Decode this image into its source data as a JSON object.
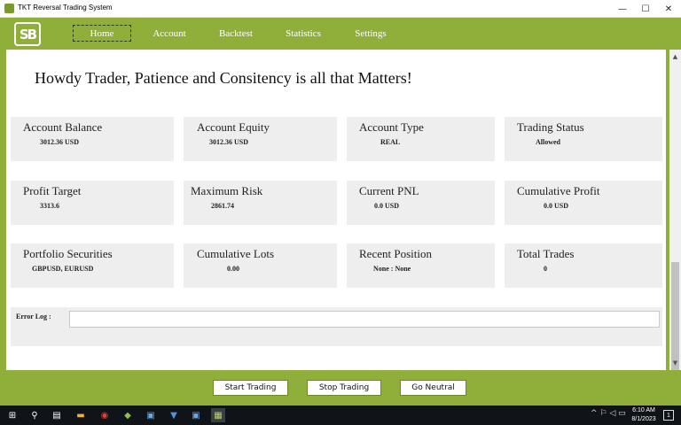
{
  "window": {
    "title": "TKT Reversal Trading System",
    "controls": [
      "—",
      "☐",
      "✕"
    ]
  },
  "header": {
    "logo_text": "SB",
    "nav": [
      {
        "label": "Home",
        "active": true
      },
      {
        "label": "Account",
        "active": false
      },
      {
        "label": "Backtest",
        "active": false
      },
      {
        "label": "Statistics",
        "active": false
      },
      {
        "label": "Settings",
        "active": false
      }
    ]
  },
  "greeting": "Howdy Trader, Patience and Consitency is all that Matters!",
  "cards": {
    "account_balance": {
      "label": "Account Balance",
      "value": "3012.36 USD"
    },
    "account_equity": {
      "label": "Account Equity",
      "value": "3012.36 USD"
    },
    "account_type": {
      "label": "Account Type",
      "value": "REAL"
    },
    "trading_status": {
      "label": "Trading Status",
      "value": "Allowed"
    },
    "profit_target": {
      "label": "Profit Target",
      "value": "3313.6"
    },
    "maximum_risk": {
      "label": "Maximum Risk",
      "value": "2861.74"
    },
    "current_pnl": {
      "label": "Current PNL",
      "value": "0.0 USD"
    },
    "cumulative_profit": {
      "label": "Cumulative Profit",
      "value": "0.0 USD"
    },
    "portfolio_securities": {
      "label": "Portfolio Securities",
      "value": "GBPUSD, EURUSD"
    },
    "cumulative_lots": {
      "label": "Cumulative Lots",
      "value": "0.00"
    },
    "recent_position": {
      "label": "Recent Position",
      "value": "None : None"
    },
    "total_trades": {
      "label": "Total Trades",
      "value": "0"
    }
  },
  "error_log": {
    "label": "Error Log :",
    "value": ""
  },
  "footer": {
    "start": "Start Trading",
    "stop": "Stop Trading",
    "neutral": "Go Neutral"
  },
  "taskbar": {
    "time": "6:10 AM",
    "date": "8/1/2023",
    "tray_icons": "^ ⚐ ◁ ▭",
    "notification_count": "1"
  },
  "colors": {
    "brand_green": "#8faf3a",
    "card_gray": "#eeeeee"
  }
}
